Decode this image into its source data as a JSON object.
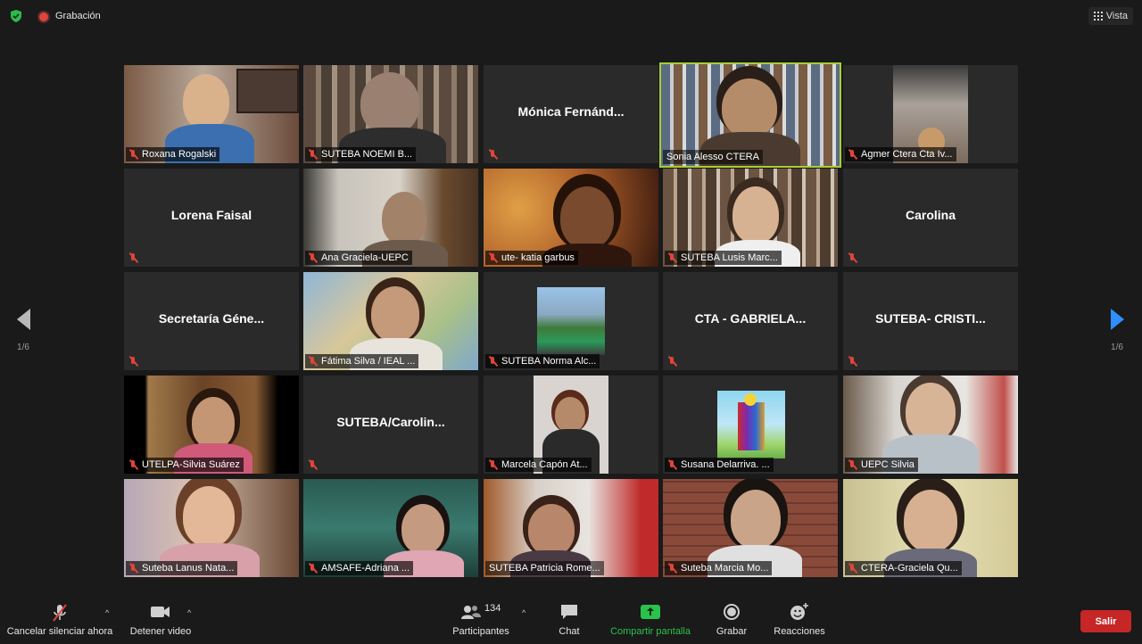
{
  "topbar": {
    "recording_label": "Grabación",
    "view_label": "Vista"
  },
  "pagination": {
    "left_page": "1/6",
    "right_page": "1/6"
  },
  "participants": [
    {
      "name": "Roxana Rogalski",
      "video": true,
      "muted": true
    },
    {
      "name": "SUTEBA  NOEMI B...",
      "video": true,
      "muted": true
    },
    {
      "name": "",
      "display_name": "Mónica  Fernánd...",
      "video": false,
      "muted": true
    },
    {
      "name": "Sonia Alesso CTERA",
      "video": true,
      "muted": false,
      "active_speaker": true
    },
    {
      "name": "Agmer Ctera Cta Iv...",
      "video": true,
      "muted": true
    },
    {
      "name": "",
      "display_name": "Lorena Faisal",
      "video": false,
      "muted": true
    },
    {
      "name": "Ana Graciela-UEPC",
      "video": true,
      "muted": true
    },
    {
      "name": "ute- katia garbus",
      "video": true,
      "muted": true
    },
    {
      "name": "SUTEBA Lusis Marc...",
      "video": true,
      "muted": true
    },
    {
      "name": "",
      "display_name": "Carolina",
      "video": false,
      "muted": true
    },
    {
      "name": "",
      "display_name": "Secretaría  Géne...",
      "video": false,
      "muted": true
    },
    {
      "name": "Fátima Silva / IEAL ...",
      "video": true,
      "muted": true
    },
    {
      "name": "SUTEBA Norma Alc...",
      "video": true,
      "muted": true
    },
    {
      "name": "",
      "display_name": "CTA - GABRIELA...",
      "video": false,
      "muted": true
    },
    {
      "name": "",
      "display_name": "SUTEBA-  CRISTI...",
      "video": false,
      "muted": true
    },
    {
      "name": "UTELPA-Silvia Suárez",
      "video": true,
      "muted": true
    },
    {
      "name": "",
      "display_name": "SUTEBA/Carolin...",
      "video": false,
      "muted": true
    },
    {
      "name": "Marcela Capón At...",
      "video": true,
      "muted": true
    },
    {
      "name": "Susana Delarriva. ...",
      "video": true,
      "muted": true
    },
    {
      "name": "UEPC Silvia",
      "video": true,
      "muted": true
    },
    {
      "name": "Suteba Lanus Nata...",
      "video": true,
      "muted": true
    },
    {
      "name": "AMSAFE-Adriana ...",
      "video": true,
      "muted": true
    },
    {
      "name": "SUTEBA Patricia Rome...",
      "video": true,
      "muted": true
    },
    {
      "name": "Suteba Marcia Mo...",
      "video": true,
      "muted": true
    },
    {
      "name": "CTERA-Graciela Qu...",
      "video": true,
      "muted": true
    }
  ],
  "toolbar": {
    "unmute_label": "Cancelar silenciar ahora",
    "video_label": "Detener video",
    "participants_label": "Participantes",
    "participants_count": "134",
    "chat_label": "Chat",
    "share_label": "Compartir pantalla",
    "record_label": "Grabar",
    "reactions_label": "Reacciones",
    "exit_label": "Salir"
  },
  "colors": {
    "share_green": "#29c24b",
    "active_speaker_border": "#a6cf35",
    "exit_red": "#c62626",
    "mute_red": "#e0453a"
  }
}
